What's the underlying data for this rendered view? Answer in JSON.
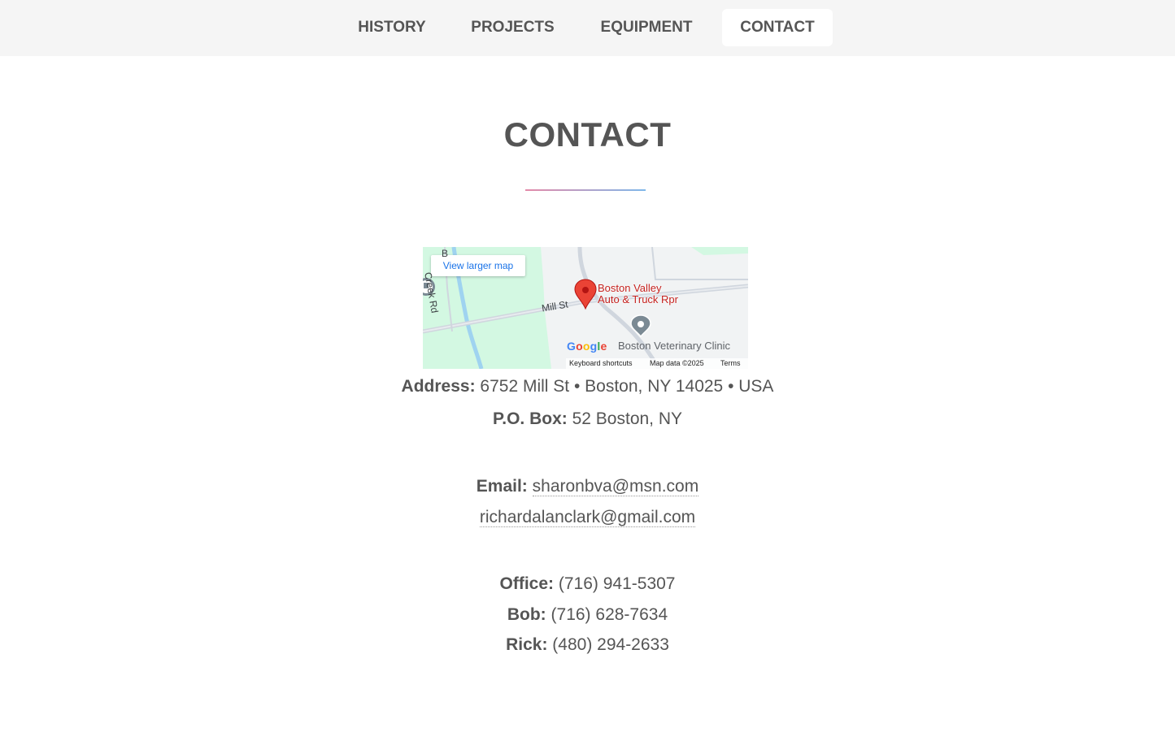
{
  "nav": {
    "items": [
      {
        "label": "HISTORY"
      },
      {
        "label": "PROJECTS"
      },
      {
        "label": "EQUIPMENT"
      },
      {
        "label": "CONTACT",
        "active": true
      }
    ]
  },
  "page": {
    "title": "CONTACT"
  },
  "colors": {
    "nav_bg": "#f5f5f5",
    "text": "#555555",
    "rule_start": "#e48aa9",
    "rule_end": "#7fb8ea"
  },
  "map": {
    "view_larger_label": "View larger map",
    "place_name_line1": "Boston Valley",
    "place_name_line2": "Auto & Truck Rpr",
    "nearby_place": "Boston Veterinary Clinic",
    "street_mill": "Mill St",
    "street_creek": "Creek Rd",
    "street_creek_prefix": "B",
    "logo_text": "Google",
    "attrib_shortcuts": "Keyboard shortcuts",
    "attrib_data": "Map data ©2025",
    "attrib_terms": "Terms",
    "marker_icon": "map-pin-icon",
    "poi_icon": "poi-pin-icon"
  },
  "contact": {
    "address_label": "Address:",
    "address_value": "6752 Mill St • Boston, NY 14025 • USA",
    "pobox_label": "P.O. Box:",
    "pobox_value": "52 Boston, NY",
    "email_label": "Email:",
    "email_1": "sharonbva@msn.com",
    "email_2": "richardalanclark@gmail.com",
    "office_label": "Office:",
    "office_phone": "(716) 941-5307",
    "bob_label": "Bob:",
    "bob_phone": "(716) 628-7634",
    "rick_label": "Rick:",
    "rick_phone": "(480) 294-2633"
  }
}
